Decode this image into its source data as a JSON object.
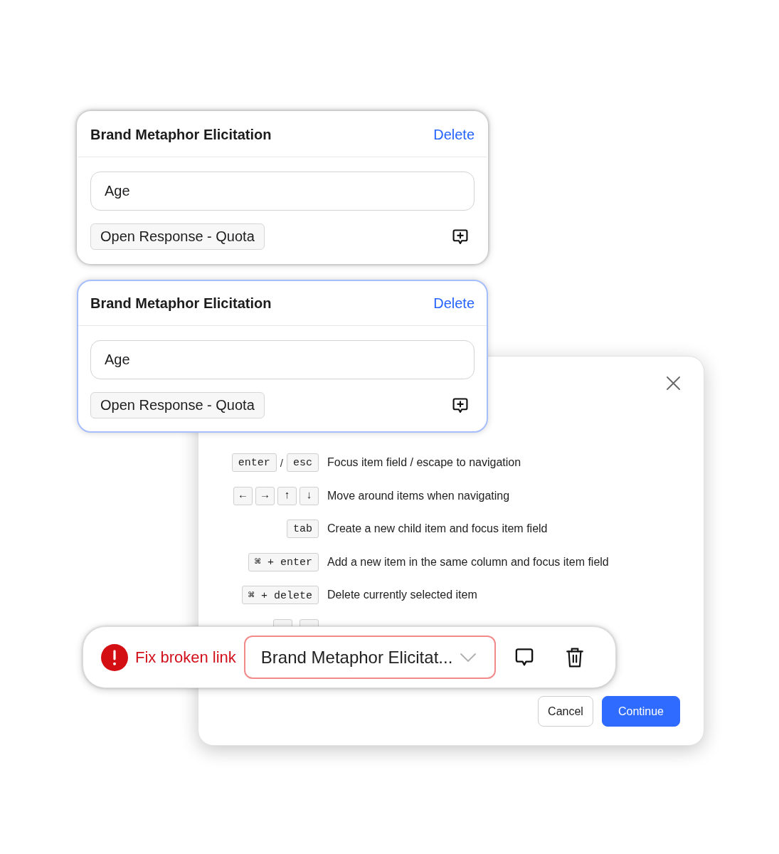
{
  "cards": [
    {
      "title": "Brand Metaphor Elicitation",
      "delete_label": "Delete",
      "answer_value": "Age",
      "type_label": "Open Response - Quota",
      "selected": false
    },
    {
      "title": "Brand Metaphor Elicitation",
      "delete_label": "Delete",
      "answer_value": "Age",
      "type_label": "Open Response - Quota",
      "selected": true
    }
  ],
  "shortcuts_dialog": {
    "rows": [
      {
        "keys": [
          {
            "kind": "key",
            "label": "enter"
          },
          {
            "kind": "separator",
            "label": "/"
          },
          {
            "kind": "key",
            "label": "esc"
          }
        ],
        "description": "Focus item field / escape to navigation"
      },
      {
        "keys": [
          {
            "kind": "key",
            "label": "←"
          },
          {
            "kind": "key",
            "label": "→"
          },
          {
            "kind": "key",
            "label": "↑"
          },
          {
            "kind": "key",
            "label": "↓"
          }
        ],
        "description": "Move around items when navigating"
      },
      {
        "keys": [
          {
            "kind": "key",
            "label": "tab"
          }
        ],
        "description": "Create a new child item and focus item field"
      },
      {
        "keys": [
          {
            "kind": "key",
            "label": "⌘ + enter"
          }
        ],
        "description": "Add a new item in the same column and focus item field"
      },
      {
        "keys": [
          {
            "kind": "key",
            "label": "⌘ + delete"
          }
        ],
        "description": "Delete currently selected item"
      },
      {
        "keys": [
          {
            "kind": "blank"
          },
          {
            "kind": "blank"
          }
        ]
      }
    ],
    "buttons": [
      {
        "label": "Cancel",
        "kind": "secondary"
      },
      {
        "label": "Continue",
        "kind": "primary"
      }
    ]
  },
  "link_bar": {
    "error_label": "Fix broken link",
    "select_value": "Brand Metaphor Elicitat..."
  }
}
